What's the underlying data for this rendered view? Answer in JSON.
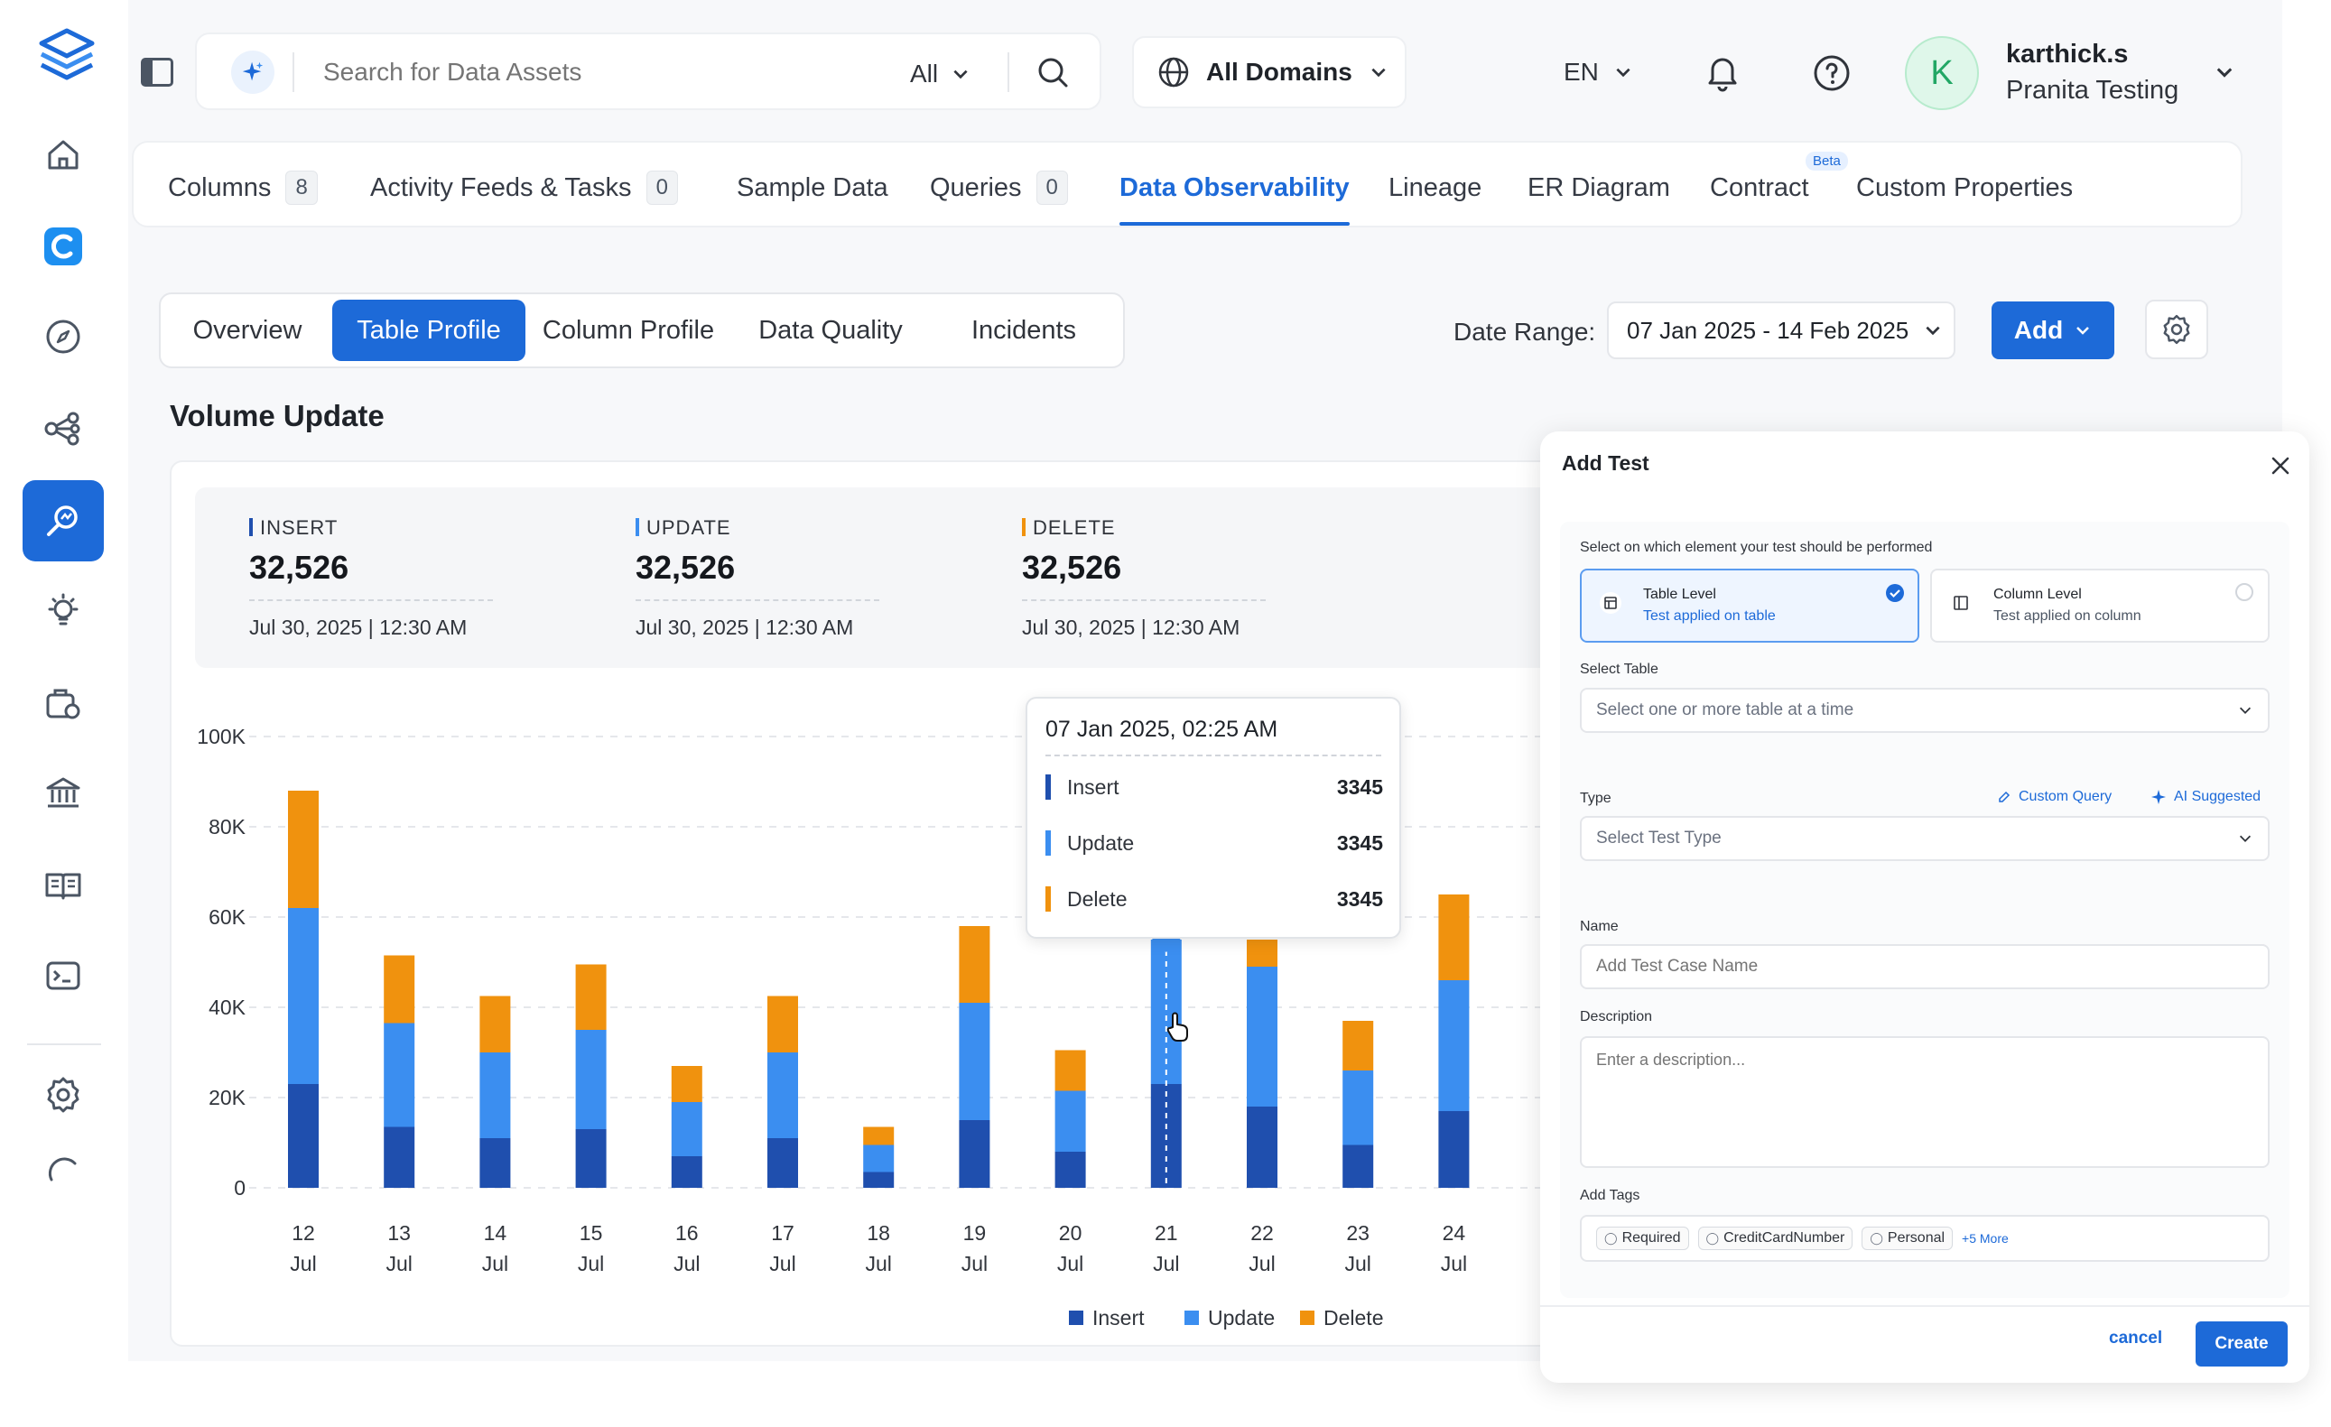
{
  "search": {
    "placeholder": "Search for Data Assets",
    "scope": "All"
  },
  "domain": {
    "label": "All Domains"
  },
  "language": "EN",
  "user": {
    "initial": "K",
    "name": "karthick.s",
    "org": "Pranita Testing"
  },
  "tabs": [
    {
      "label": "Columns",
      "count": "8"
    },
    {
      "label": "Activity Feeds & Tasks",
      "count": "0"
    },
    {
      "label": "Sample Data"
    },
    {
      "label": "Queries",
      "count": "0"
    },
    {
      "label": "Data Observability"
    },
    {
      "label": "Lineage"
    },
    {
      "label": "ER Diagram"
    },
    {
      "label": "Contract",
      "badge": "Beta"
    },
    {
      "label": "Custom Properties"
    }
  ],
  "subtabs": [
    "Overview",
    "Table Profile",
    "Column Profile",
    "Data Quality",
    "Incidents"
  ],
  "date_range": {
    "label": "Date Range:",
    "value": "07 Jan 2025 - 14 Feb 2025"
  },
  "add_button": "Add",
  "section_title": "Volume Update",
  "stats": [
    {
      "label": "INSERT",
      "value": "32,526",
      "time": "Jul 30, 2025 | 12:30 AM",
      "color": "#1f4fae"
    },
    {
      "label": "UPDATE",
      "value": "32,526",
      "time": "Jul 30, 2025 | 12:30 AM",
      "color": "#3b8ef0"
    },
    {
      "label": "DELETE",
      "value": "32,526",
      "time": "Jul 30, 2025 | 12:30 AM",
      "color": "#f0920e"
    }
  ],
  "chart_data": {
    "type": "bar",
    "stacked": true,
    "categories": [
      "12 Jul",
      "13 Jul",
      "14 Jul",
      "15 Jul",
      "16 Jul",
      "17 Jul",
      "18 Jul",
      "19 Jul",
      "20 Jul",
      "21 Jul",
      "22 Jul",
      "23 Jul",
      "24 Jul"
    ],
    "series": [
      {
        "name": "Insert",
        "color": "#1f4fae",
        "values": [
          23000,
          13500,
          11000,
          13000,
          7000,
          11000,
          3500,
          15000,
          8000,
          23000,
          18000,
          9500,
          17000
        ]
      },
      {
        "name": "Update",
        "color": "#3b8ef0",
        "values": [
          39000,
          23000,
          19000,
          22000,
          12000,
          19000,
          6000,
          26000,
          13500,
          32000,
          31000,
          16500,
          29000
        ]
      },
      {
        "name": "Delete",
        "color": "#f0920e",
        "values": [
          26000,
          15000,
          12500,
          14500,
          8000,
          12500,
          4000,
          17000,
          9000,
          0,
          6000,
          11000,
          19000
        ]
      }
    ],
    "y_ticks": [
      "0",
      "20K",
      "40K",
      "60K",
      "80K",
      "100K"
    ],
    "ylim": [
      0,
      100000
    ],
    "legend": "bottom-center",
    "grid": true
  },
  "tooltip": {
    "title": "07 Jan 2025, 02:25 AM",
    "rows": [
      {
        "label": "Insert",
        "value": "3345",
        "color": "#1f4fae"
      },
      {
        "label": "Update",
        "value": "3345",
        "color": "#3b8ef0"
      },
      {
        "label": "Delete",
        "value": "3345",
        "color": "#f0920e"
      }
    ]
  },
  "drawer": {
    "title": "Add Test",
    "element_prompt": "Select on which element your test should be performed",
    "table_level": {
      "title": "Table Level",
      "desc": "Test applied on table"
    },
    "column_level": {
      "title": "Column Level",
      "desc": "Test applied on column"
    },
    "select_table_label": "Select Table",
    "select_table_placeholder": "Select one or more table at a time",
    "type_label": "Type",
    "custom_query": "Custom Query",
    "ai_suggested": "AI Suggested",
    "type_placeholder": "Select Test Type",
    "name_label": "Name",
    "name_placeholder": "Add Test Case Name",
    "description_label": "Description",
    "description_placeholder": "Enter a description...",
    "tags_label": "Add Tags",
    "tags": [
      "Required",
      "CreditCardNumber",
      "Personal"
    ],
    "more_tags": "+5 More",
    "cancel": "cancel",
    "create": "Create"
  }
}
